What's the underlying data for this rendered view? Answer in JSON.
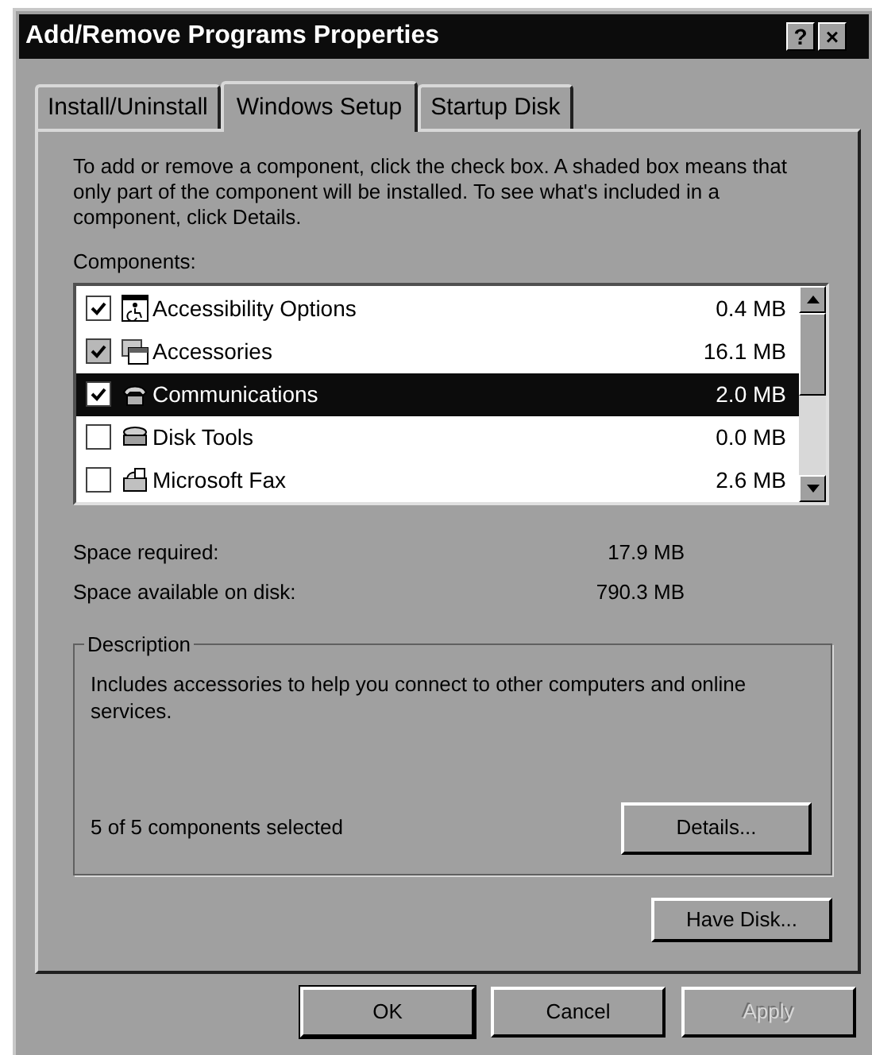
{
  "window": {
    "title": "Add/Remove Programs Properties",
    "buttons": [
      "?",
      "×"
    ]
  },
  "tabs": [
    {
      "label": "Install/Uninstall",
      "selected": false
    },
    {
      "label": "Windows Setup",
      "selected": true
    },
    {
      "label": "Startup Disk",
      "selected": false
    }
  ],
  "intro": "To add or remove a component, click the check box. A shaded box means that only part of the component will be installed. To see what's included in a component, click Details.",
  "components_label": "Components:",
  "components": [
    {
      "name": "Accessibility Options",
      "size": "0.4 MB",
      "checked": true,
      "shaded": false,
      "selected": false,
      "kind": "accessibility"
    },
    {
      "name": "Accessories",
      "size": "16.1 MB",
      "checked": true,
      "shaded": true,
      "selected": false,
      "kind": "accessories"
    },
    {
      "name": "Communications",
      "size": "2.0 MB",
      "checked": true,
      "shaded": false,
      "selected": true,
      "kind": "phone"
    },
    {
      "name": "Disk Tools",
      "size": "0.0 MB",
      "checked": false,
      "shaded": false,
      "selected": false,
      "kind": "disk"
    },
    {
      "name": "Microsoft Fax",
      "size": "2.6 MB",
      "checked": false,
      "shaded": false,
      "selected": false,
      "kind": "fax"
    }
  ],
  "space": [
    {
      "label": "Space required:",
      "value": "17.9 MB"
    },
    {
      "label": "Space available on disk:",
      "value": "790.3 MB"
    }
  ],
  "description": {
    "title": "Description",
    "text": "Includes accessories to help you connect to other computers and online services.",
    "count": "5 of 5 components selected",
    "details_button": "Details..."
  },
  "have_disk_button": "Have Disk...",
  "buttons": [
    {
      "label": "OK",
      "disabled": false,
      "default": true
    },
    {
      "label": "Cancel",
      "disabled": false,
      "default": false
    },
    {
      "label": "Apply",
      "disabled": true,
      "default": false
    }
  ]
}
